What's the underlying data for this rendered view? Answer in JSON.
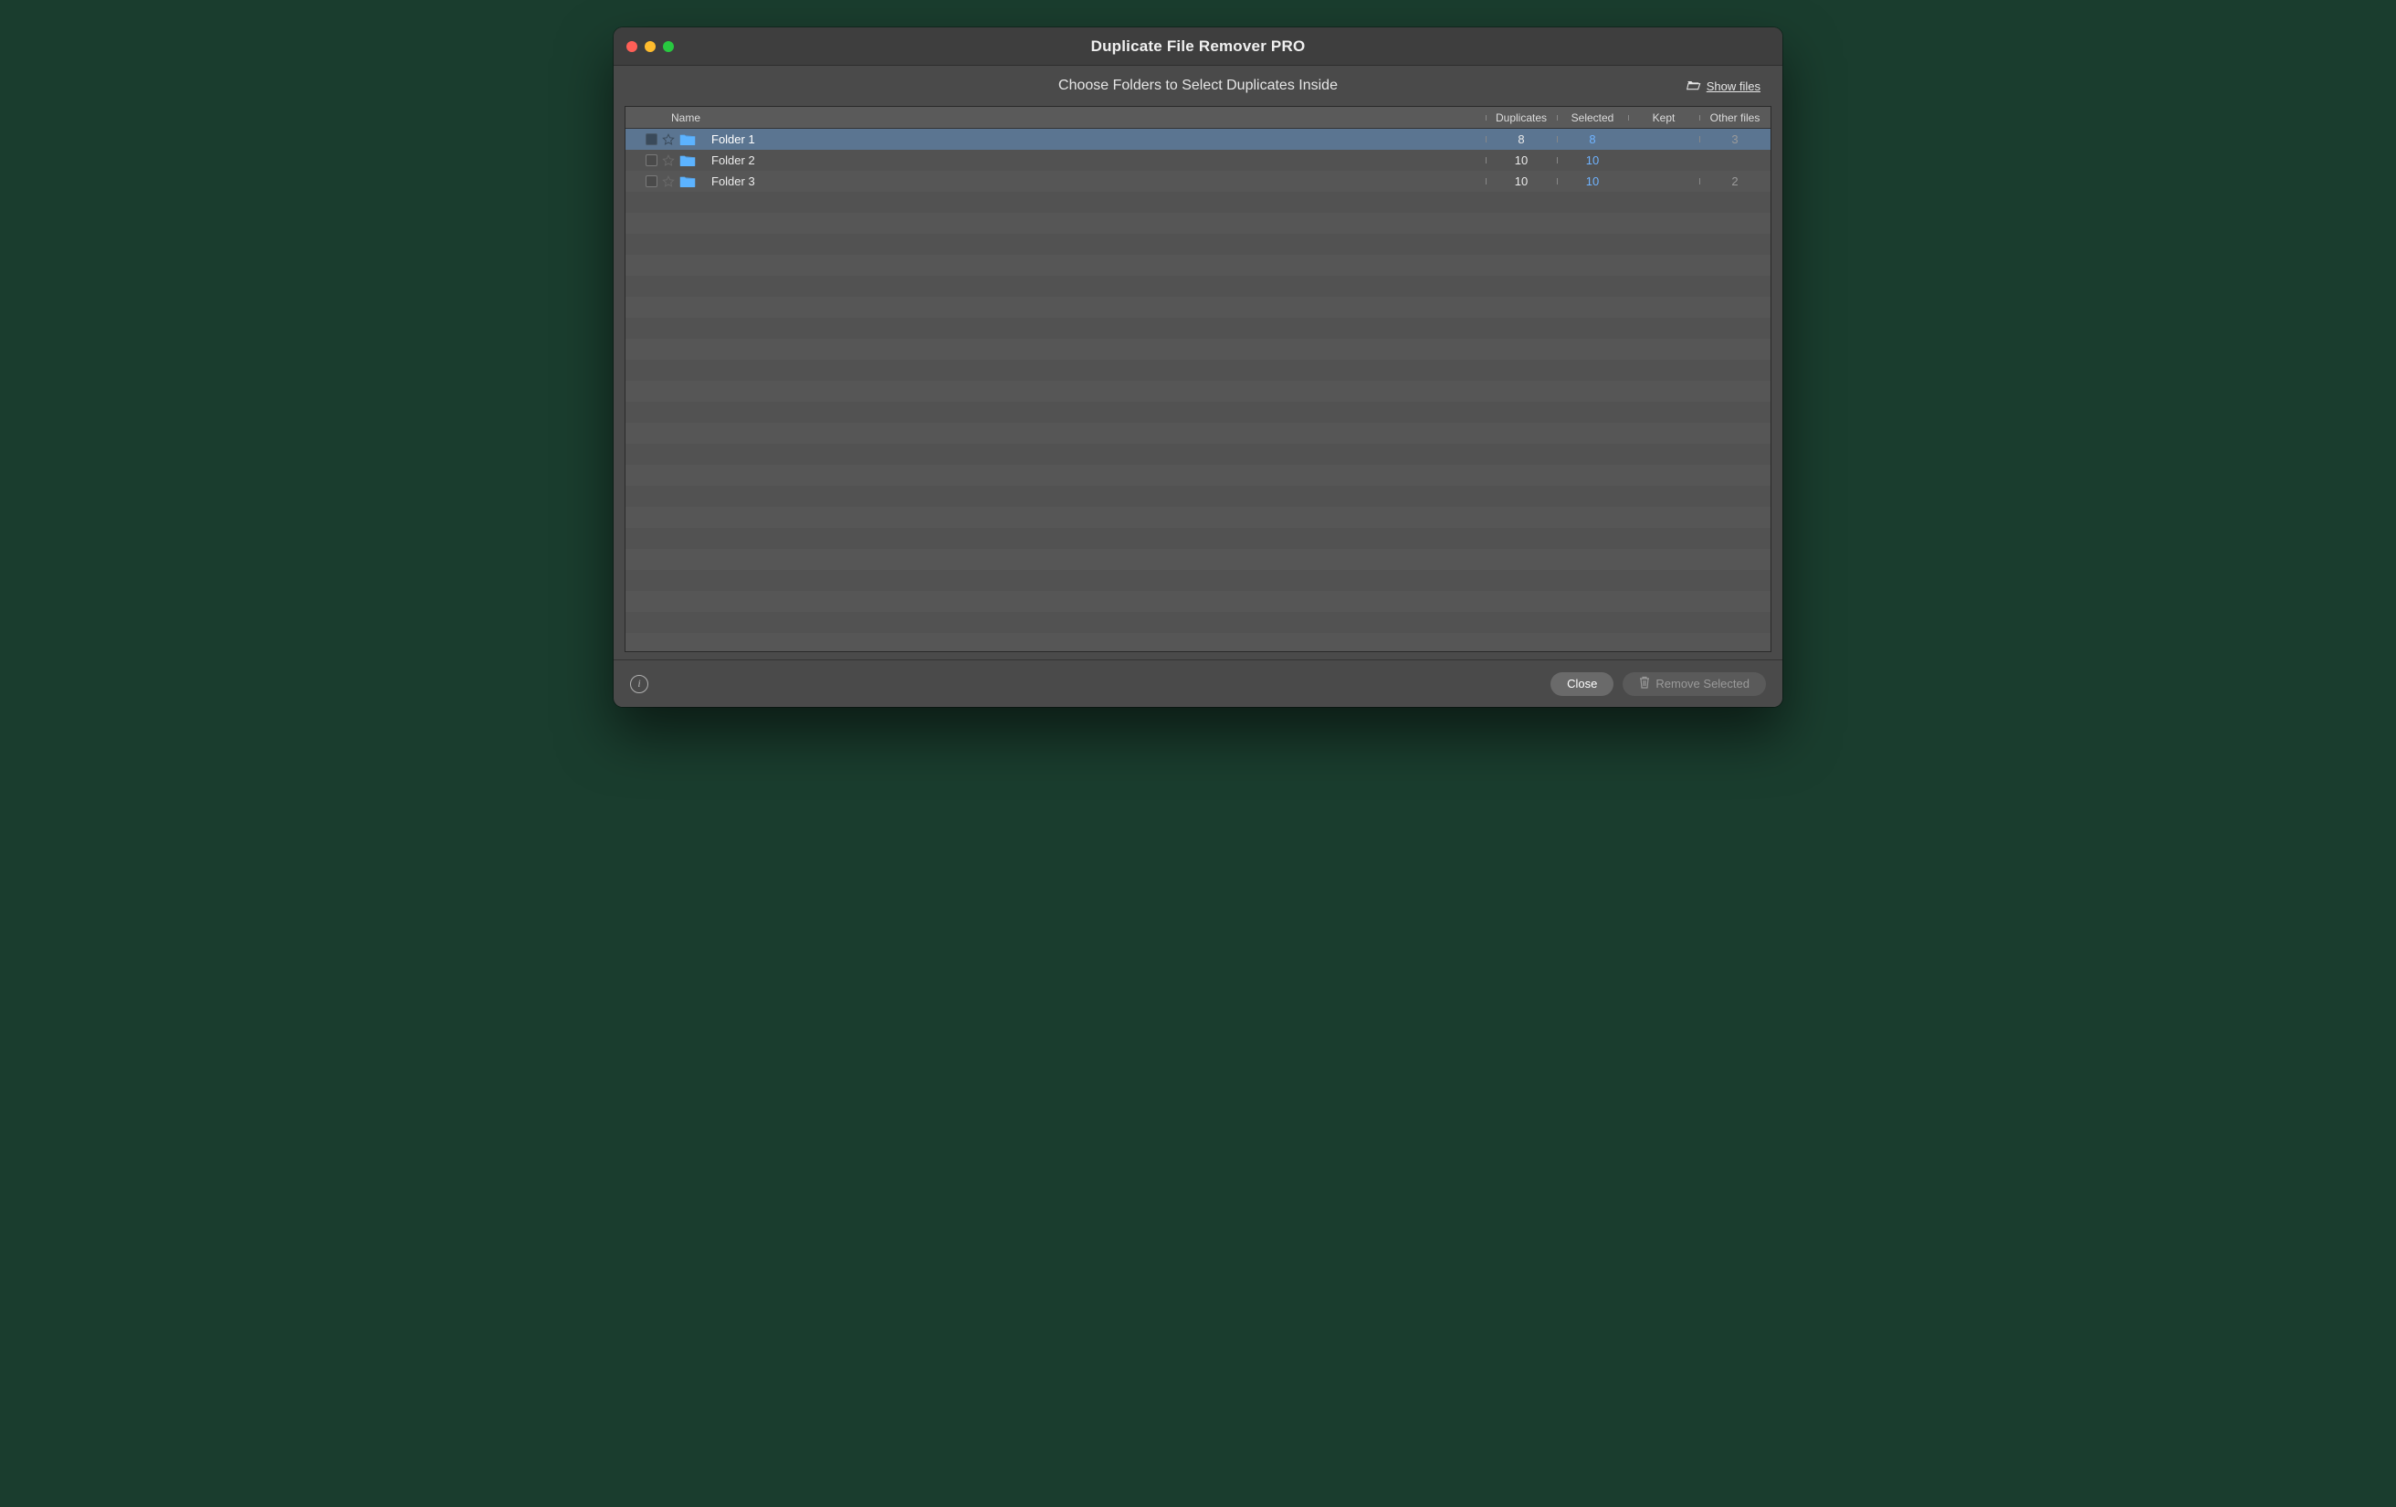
{
  "window": {
    "title": "Duplicate File Remover PRO",
    "subtitle": "Choose Folders to Select Duplicates Inside",
    "show_files_label": "Show files"
  },
  "columns": {
    "name": "Name",
    "duplicates": "Duplicates",
    "selected": "Selected",
    "kept": "Kept",
    "other_files": "Other files"
  },
  "folders": [
    {
      "name": "Folder 1",
      "duplicates": "8",
      "selected": "8",
      "kept": "",
      "other": "3",
      "highlighted": true
    },
    {
      "name": "Folder 2",
      "duplicates": "10",
      "selected": "10",
      "kept": "",
      "other": "",
      "highlighted": false
    },
    {
      "name": "Folder 3",
      "duplicates": "10",
      "selected": "10",
      "kept": "",
      "other": "2",
      "highlighted": false
    }
  ],
  "footer": {
    "close_label": "Close",
    "remove_label": "Remove Selected"
  },
  "colors": {
    "selected_text": "#6fb3ff",
    "row_highlight": "#5b7591",
    "folder_icon": "#5cb3ff"
  }
}
